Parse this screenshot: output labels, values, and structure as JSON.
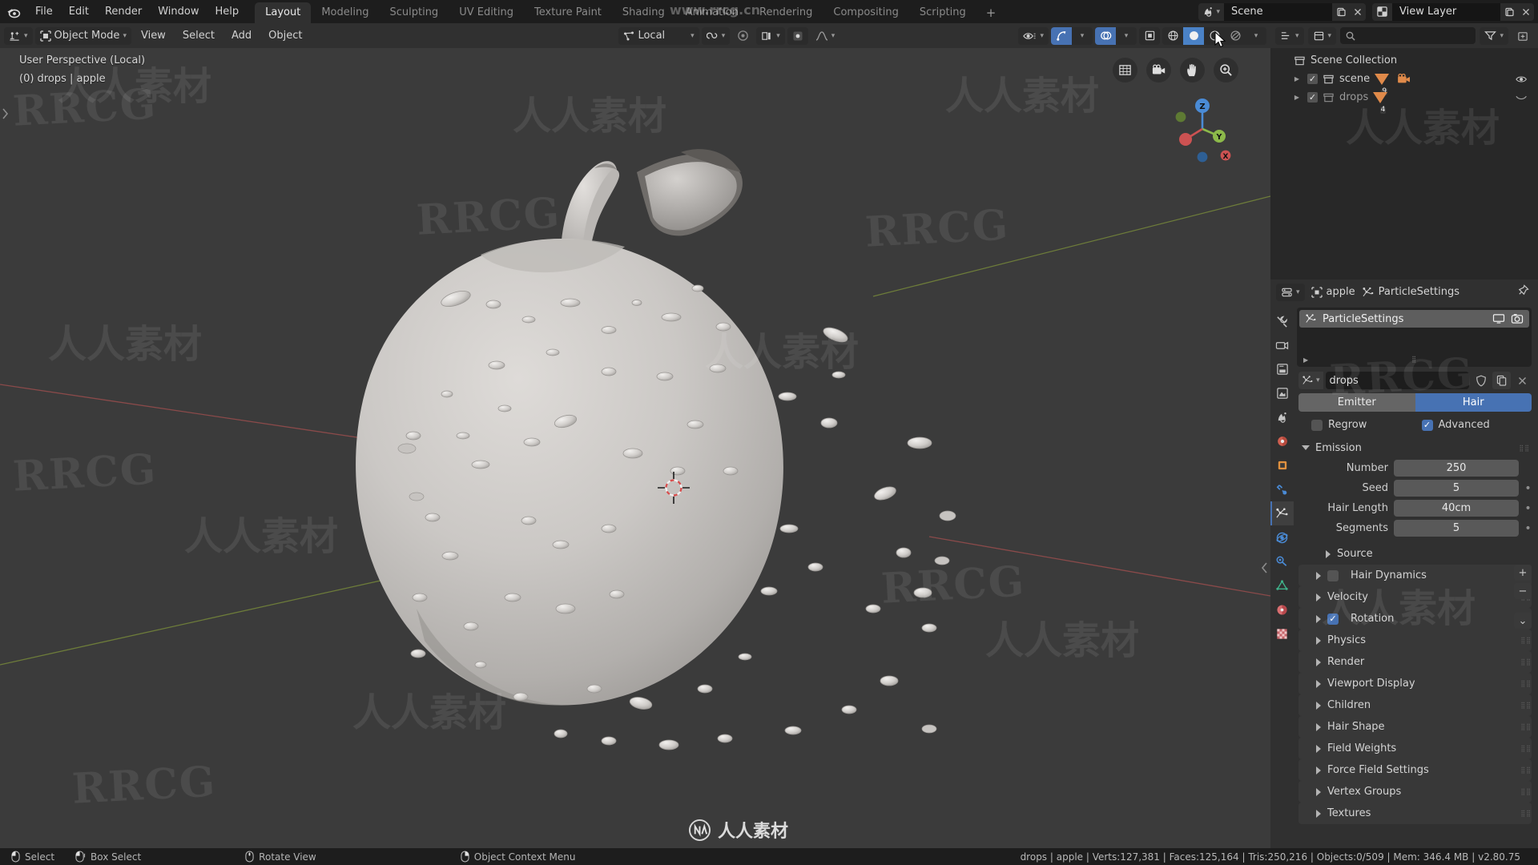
{
  "app": {
    "name": "Blender",
    "version_label": "v2.80.75"
  },
  "topbar": {
    "menus": [
      "File",
      "Edit",
      "Render",
      "Window",
      "Help"
    ],
    "workspaces": [
      {
        "label": "Layout",
        "active": true
      },
      {
        "label": "Modeling",
        "active": false
      },
      {
        "label": "Sculpting",
        "active": false
      },
      {
        "label": "UV Editing",
        "active": false
      },
      {
        "label": "Texture Paint",
        "active": false
      },
      {
        "label": "Shading",
        "active": false
      },
      {
        "label": "Animation",
        "active": false
      },
      {
        "label": "Rendering",
        "active": false
      },
      {
        "label": "Compositing",
        "active": false
      },
      {
        "label": "Scripting",
        "active": false
      }
    ],
    "add_workspace_label": "+",
    "scene_name": "Scene",
    "view_layer_name": "View Layer"
  },
  "viewport_header": {
    "mode": "Object Mode",
    "menus": [
      "View",
      "Select",
      "Add",
      "Object"
    ],
    "transform_orientation": "Local",
    "shading_modes": [
      "wireframe",
      "solid",
      "material-preview",
      "rendered"
    ],
    "active_shading_mode": "solid"
  },
  "viewport": {
    "overlay_line1": "User Perspective (Local)",
    "overlay_line2": "(0) drops | apple",
    "gizmo_axes": [
      "Z",
      "Y",
      "X"
    ]
  },
  "outliner": {
    "search_placeholder": "",
    "rows": [
      {
        "label": "Scene Collection",
        "level": 1,
        "checkbox": false,
        "disclosure": false,
        "badge": "",
        "dim": false
      },
      {
        "label": "scene",
        "level": 2,
        "checkbox": true,
        "disclosure": true,
        "badge": "9",
        "dim": false
      },
      {
        "label": "drops",
        "level": 2,
        "checkbox": true,
        "disclosure": true,
        "badge": "4",
        "dim": true
      }
    ]
  },
  "properties": {
    "breadcrumb": [
      "apple",
      "ParticleSettings"
    ],
    "particle_systems": [
      {
        "name": "ParticleSettings",
        "selected": true
      }
    ],
    "list_buttons": [
      "+",
      "−",
      "⌄"
    ],
    "datablock_name": "drops",
    "type_toggle": {
      "options": [
        "Emitter",
        "Hair"
      ],
      "selected": "Hair"
    },
    "checkboxes": [
      {
        "label": "Regrow",
        "checked": false
      },
      {
        "label": "Advanced",
        "checked": true
      }
    ],
    "emission": {
      "title": "Emission",
      "open": true,
      "fields": [
        {
          "label": "Number",
          "value": "250",
          "animatable": false
        },
        {
          "label": "Seed",
          "value": "5",
          "animatable": true
        },
        {
          "label": "Hair Length",
          "value": "40cm",
          "animatable": true
        },
        {
          "label": "Segments",
          "value": "5",
          "animatable": true
        }
      ],
      "sub_panels": [
        {
          "label": "Source",
          "open": false
        }
      ]
    },
    "panels": [
      {
        "label": "Hair Dynamics",
        "open": false,
        "checkbox": false,
        "has_checkbox": true
      },
      {
        "label": "Velocity",
        "open": false,
        "has_checkbox": false
      },
      {
        "label": "Rotation",
        "open": false,
        "checkbox": true,
        "has_checkbox": true
      },
      {
        "label": "Physics",
        "open": false,
        "has_checkbox": false
      },
      {
        "label": "Render",
        "open": false,
        "has_checkbox": false
      },
      {
        "label": "Viewport Display",
        "open": false,
        "has_checkbox": false
      },
      {
        "label": "Children",
        "open": false,
        "has_checkbox": false
      },
      {
        "label": "Hair Shape",
        "open": false,
        "has_checkbox": false
      },
      {
        "label": "Field Weights",
        "open": false,
        "has_checkbox": false
      },
      {
        "label": "Force Field Settings",
        "open": false,
        "has_checkbox": false
      },
      {
        "label": "Vertex Groups",
        "open": false,
        "has_checkbox": false
      },
      {
        "label": "Textures",
        "open": false,
        "has_checkbox": false
      }
    ],
    "tabs": [
      "tool-icon",
      "render-icon",
      "output-icon",
      "view-layer-icon",
      "scene-icon",
      "world-icon",
      "object-icon",
      "modifier-icon",
      "particles-icon",
      "physics-icon",
      "constraint-icon",
      "data-icon",
      "material-icon",
      "texture-icon"
    ],
    "active_tab": "particles-icon"
  },
  "statusbar": {
    "hints": [
      {
        "icon": "mouse-left-icon",
        "label": "Select"
      },
      {
        "icon": "mouse-left-drag-icon",
        "label": "Box Select"
      },
      {
        "icon": "mouse-middle-icon",
        "label": "Rotate View"
      },
      {
        "icon": "mouse-right-icon",
        "label": "Object Context Menu"
      }
    ],
    "stats": "drops | apple | Verts:127,381 | Faces:125,164 | Tris:250,216 | Objects:0/509 | Mem: 346.4 MB | v2.80.75"
  },
  "watermarks": {
    "url": "www.rrcg.cn",
    "brand_cn": "人人素材",
    "brand_en": "RRCG"
  },
  "theme": {
    "accent_blue": "#4772b3",
    "panel_bg": "#303030",
    "outliner_bg": "#282828",
    "viewport_bg": "#3b3b3b",
    "topbar_bg": "#1d1d1d",
    "orange": "#e08a4a"
  }
}
